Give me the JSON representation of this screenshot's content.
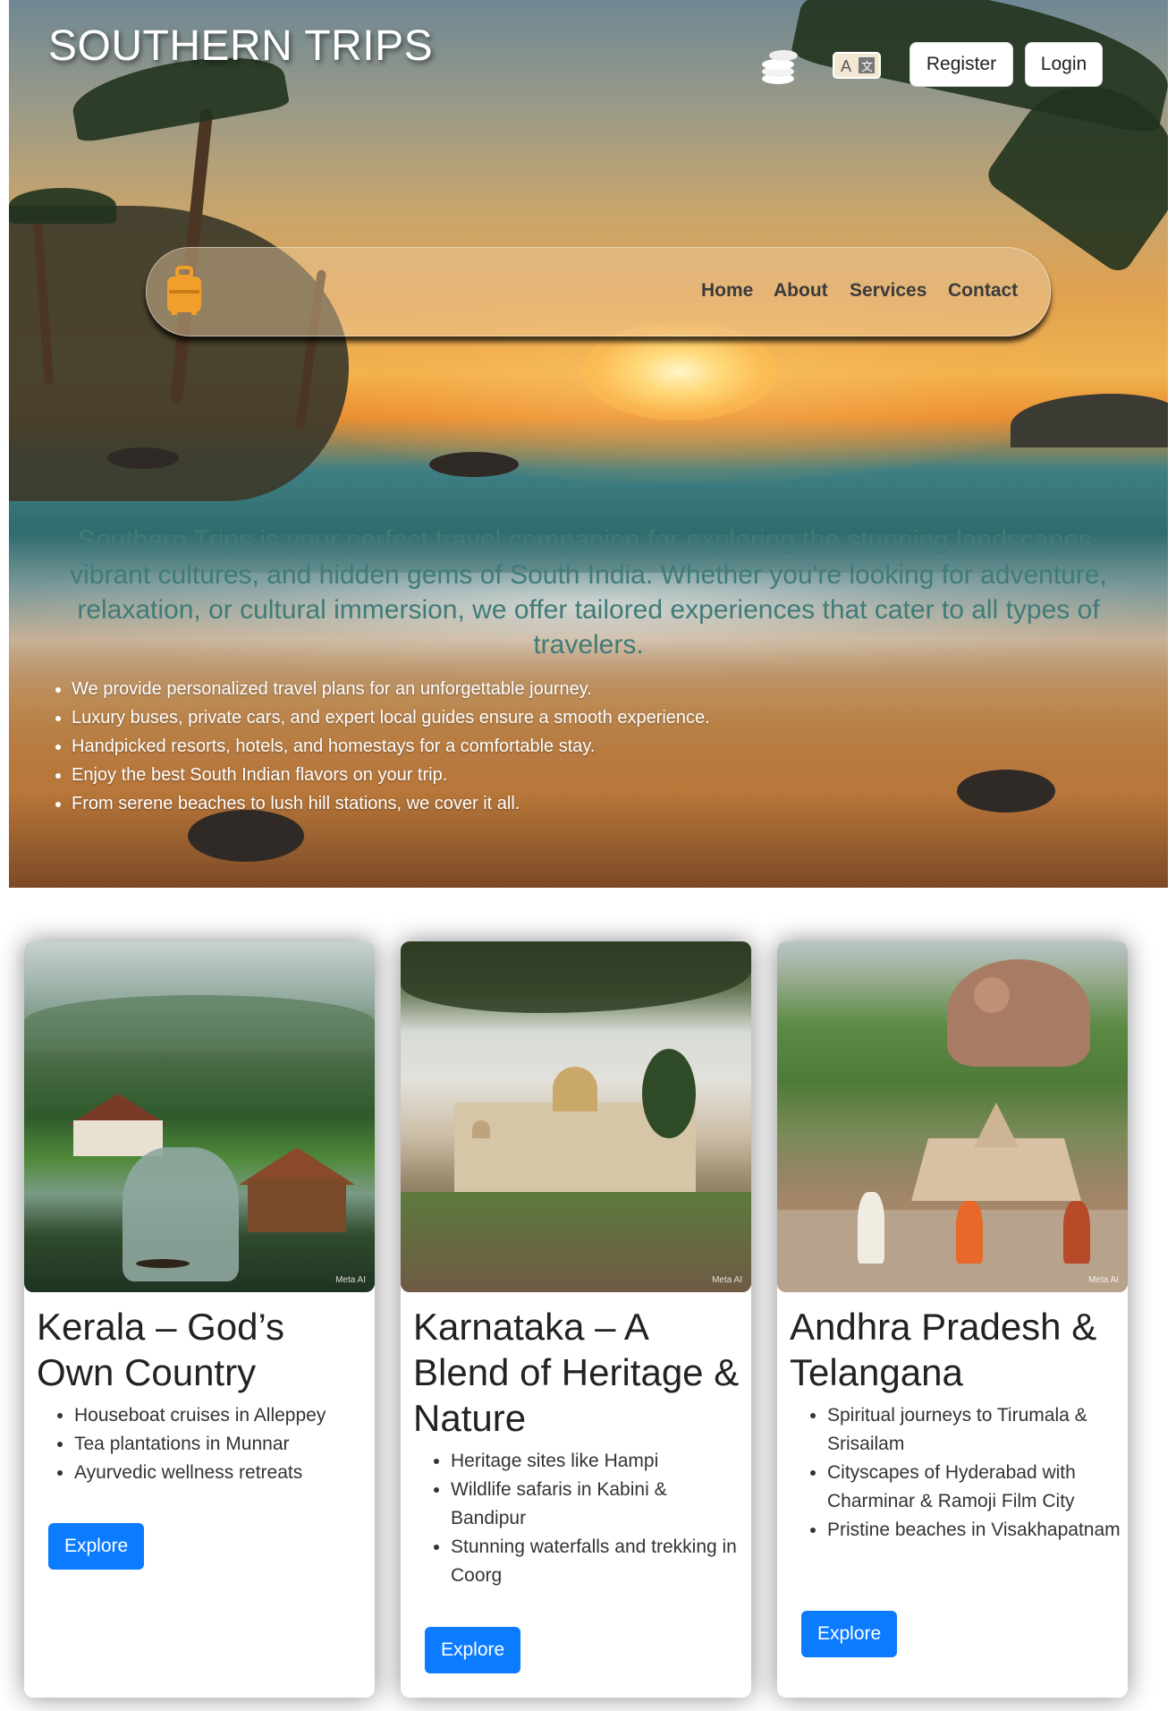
{
  "header": {
    "brand": "SOUTHERN TRIPS",
    "register_label": "Register",
    "login_label": "Login",
    "icons": [
      "coins-icon",
      "translate-icon",
      "luggage-icon"
    ]
  },
  "nav": {
    "items": [
      {
        "label": "Home"
      },
      {
        "label": "About"
      },
      {
        "label": "Services"
      },
      {
        "label": "Contact"
      }
    ]
  },
  "hero": {
    "intro": "Southern Trips is your perfect travel companion for exploring the stunning landscapes, vibrant cultures, and hidden gems of South India. Whether you're looking for adventure, relaxation, or cultural immersion, we offer tailored experiences that cater to all types of travelers.",
    "features": [
      "We provide personalized travel plans for an unforgettable journey.",
      "Luxury buses, private cars, and expert local guides ensure a smooth experience.",
      "Handpicked resorts, hotels, and homestays for a comfortable stay.",
      "Enjoy the best South Indian flavors on your trip.",
      "From serene beaches to lush hill stations, we cover it all."
    ]
  },
  "cards": [
    {
      "title": "Kerala – God’s Own Country",
      "items": [
        "Houseboat cruises in Alleppey",
        "Tea plantations in Munnar",
        "Ayurvedic wellness retreats"
      ],
      "button": "Explore",
      "watermark": "Meta AI"
    },
    {
      "title": "Karnataka – A Blend of Heritage & Nature",
      "items": [
        "Heritage sites like Hampi",
        "Wildlife safaris in Kabini & Bandipur",
        "Stunning waterfalls and trekking in Coorg"
      ],
      "button": "Explore",
      "watermark": "Meta AI"
    },
    {
      "title": "Andhra Pradesh & Telangana",
      "items": [
        "Spiritual journeys to Tirumala & Srisailam",
        "Cityscapes of Hyderabad with Charminar & Ramoji Film City",
        "Pristine beaches in Visakhapatnam"
      ],
      "button": "Explore",
      "watermark": "Meta AI"
    }
  ],
  "colors": {
    "accent": "#0b7bff",
    "hero_text": "#3f7b78",
    "luggage_icon": "#f0a02a"
  }
}
